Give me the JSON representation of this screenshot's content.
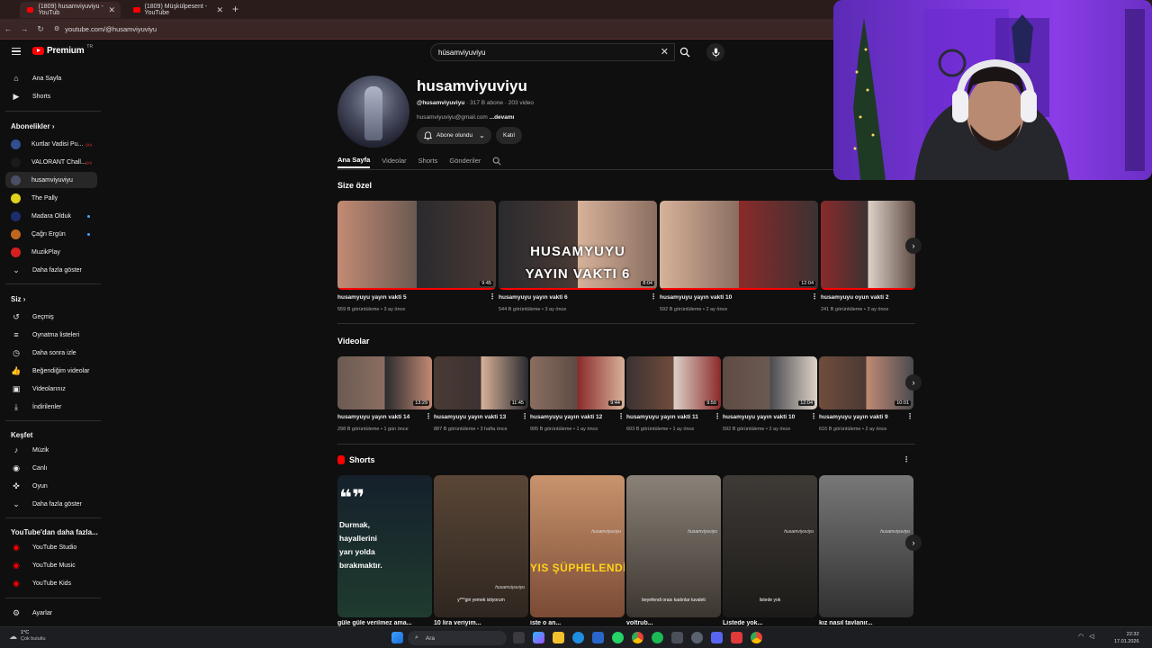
{
  "browser": {
    "tabs": [
      {
        "title": "(1809) husamviyuviyu - YouTub",
        "active": true
      },
      {
        "title": "(1809) Müşkülpesent - YouTube",
        "active": false
      }
    ],
    "url": "youtube.com/@husamviyuviyu"
  },
  "header": {
    "logo_text": "Premium",
    "logo_region": "TR",
    "search_value": "hüsamviyuviyu"
  },
  "sidebar": {
    "main": [
      {
        "label": "Ana Sayfa",
        "icon": "home-icon"
      },
      {
        "label": "Shorts",
        "icon": "shorts-icon"
      }
    ],
    "subs_heading": "Abonelikler",
    "subscriptions": [
      {
        "label": "Kurtlar Vadisi Pu...",
        "color": "#2f4f8f",
        "live": true,
        "live_text": "((•))"
      },
      {
        "label": "VALORANT Chall...",
        "color": "#1a1a1a",
        "live": true,
        "live_text": "((•))"
      },
      {
        "label": "husamviyuviyu",
        "color": "#4a4f66",
        "active": true
      },
      {
        "label": "The Pally",
        "color": "#e0d21a"
      },
      {
        "label": "Madara Olduk",
        "color": "#1b2d6b",
        "dot": true
      },
      {
        "label": "Çağrı Ergün",
        "color": "#c0671f",
        "dot": true
      },
      {
        "label": "MuzikPlay",
        "color": "#d62020"
      }
    ],
    "subs_more": "Daha fazla göster",
    "you_heading": "Siz",
    "you_items": [
      {
        "label": "Geçmiş",
        "icon": "history-icon"
      },
      {
        "label": "Oynatma listeleri",
        "icon": "playlist-icon"
      },
      {
        "label": "Daha sonra izle",
        "icon": "clock-icon"
      },
      {
        "label": "Beğendiğim videolar",
        "icon": "thumbs-up-icon"
      },
      {
        "label": "Videolarınız",
        "icon": "video-icon"
      },
      {
        "label": "İndirilenler",
        "icon": "download-icon"
      }
    ],
    "explore_heading": "Keşfet",
    "explore_items": [
      {
        "label": "Müzik",
        "icon": "music-icon"
      },
      {
        "label": "Canlı",
        "icon": "live-icon"
      },
      {
        "label": "Oyun",
        "icon": "gamepad-icon"
      },
      {
        "label": "Daha fazla göster",
        "icon": "chevron-down-icon"
      }
    ],
    "more_heading": "YouTube'dan daha fazla...",
    "more_items": [
      {
        "label": "YouTube Studio"
      },
      {
        "label": "YouTube Music"
      },
      {
        "label": "YouTube Kids"
      }
    ],
    "settings": "Ayarlar"
  },
  "channel": {
    "name": "husamviyuviyu",
    "handle": "@husamviyuviyu",
    "subscribers": "317 B abone",
    "videos": "203 video",
    "email": "husamviyuviyu@gmail.com",
    "more": "...devamı",
    "subscribed_label": "Abone olundu",
    "join_label": "Katıl",
    "tabs": [
      "Ana Sayfa",
      "Videolar",
      "Shorts",
      "Gönderiler"
    ]
  },
  "for_you": {
    "title": "Size özel",
    "videos": [
      {
        "title": "husamyuyu yayın vakti 5",
        "meta": "559 B görüntüleme • 3 ay önce",
        "duration": "9:45",
        "overlay": ""
      },
      {
        "title": "husamyuyu yayın vakti 6",
        "meta": "544 B görüntüleme • 3 ay önce",
        "duration": "8:04",
        "overlay": "HUSAMYUYU YAYIN VAKTI 6"
      },
      {
        "title": "husamyuyu yayın vakti 10",
        "meta": "592 B görüntüleme • 2 ay önce",
        "duration": "12:04",
        "overlay": ""
      },
      {
        "title": "husamyuyu oyun vakti 2",
        "meta": "241 B görüntüleme • 3 ay önce",
        "duration": "",
        "overlay": ""
      }
    ]
  },
  "videos_section": {
    "title": "Videolar",
    "videos": [
      {
        "title": "husamyuyu yayın vakti 14",
        "meta": "298 B görüntüleme • 1 gün önce",
        "duration": "13:29"
      },
      {
        "title": "husamyuyu yayın vakti 13",
        "meta": "887 B görüntüleme • 3 hafta önce",
        "duration": "11:45"
      },
      {
        "title": "husamyuyu yayın vakti 12",
        "meta": "995 B görüntüleme • 1 ay önce",
        "duration": "9:44"
      },
      {
        "title": "husamyuyu yayın vakti 11",
        "meta": "603 B görüntüleme • 1 ay önce",
        "duration": "9:50"
      },
      {
        "title": "husamyuyu yayın vakti 10",
        "meta": "592 B görüntüleme • 2 ay önce",
        "duration": "12:04"
      },
      {
        "title": "husamyuyu yayın vakti 9",
        "meta": "616 B görüntüleme • 2 ay önce",
        "duration": "10:01"
      }
    ]
  },
  "shorts_section": {
    "title": "Shorts",
    "items": [
      {
        "title": "güle güle verilmez ama...",
        "overlay": "Durmak, hayallerini yarı yolda bırakmaktır.",
        "quote": "❝❞"
      },
      {
        "title": "10 lira veriyim...",
        "overlay": "y***giri yemek istiyorum"
      },
      {
        "title": "iste o an...",
        "overlay": "YIS ŞÜPHELENDİ"
      },
      {
        "title": "voltrub...",
        "overlay": "beyefendi orası kadınlar tuvaleti"
      },
      {
        "title": "Listede yok...",
        "overlay": "listede yok"
      },
      {
        "title": "kız nasıl tavlanır...",
        "overlay": ""
      }
    ],
    "watermark": "husamviyuviyu"
  },
  "taskbar": {
    "weather_temp": "1°C",
    "weather_desc": "Çok bulutlu",
    "search_placeholder": "Ara",
    "time": "22:32",
    "date": "17.01.2026"
  }
}
